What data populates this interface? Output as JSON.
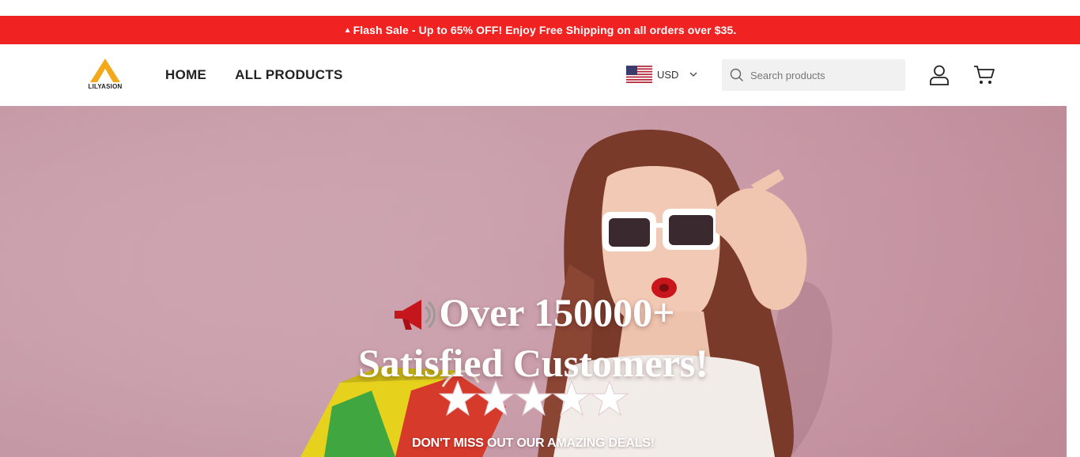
{
  "announcement": {
    "text": "Flash Sale - Up to 65% OFF! Enjoy Free Shipping on all orders over $35.",
    "icon": "fire-icon",
    "background": "#f02222"
  },
  "header": {
    "logo_text": "LILYASION",
    "nav": [
      {
        "label": "HOME"
      },
      {
        "label": "ALL PRODUCTS"
      }
    ],
    "currency": {
      "code": "USD",
      "flag": "us-flag-icon"
    },
    "search": {
      "placeholder": "Search products",
      "value": ""
    },
    "icons": [
      "search-icon",
      "account-icon",
      "cart-icon",
      "chevron-down-icon"
    ]
  },
  "hero": {
    "headline_line1": "Over 150000+",
    "headline_line2": "Satisfied Customers!",
    "stars": 5,
    "subheadline": "DON'T MISS OUT OUR AMAZING DEALS!",
    "colors": {
      "background": "#cba3ae",
      "accent": "#c4161c"
    }
  }
}
